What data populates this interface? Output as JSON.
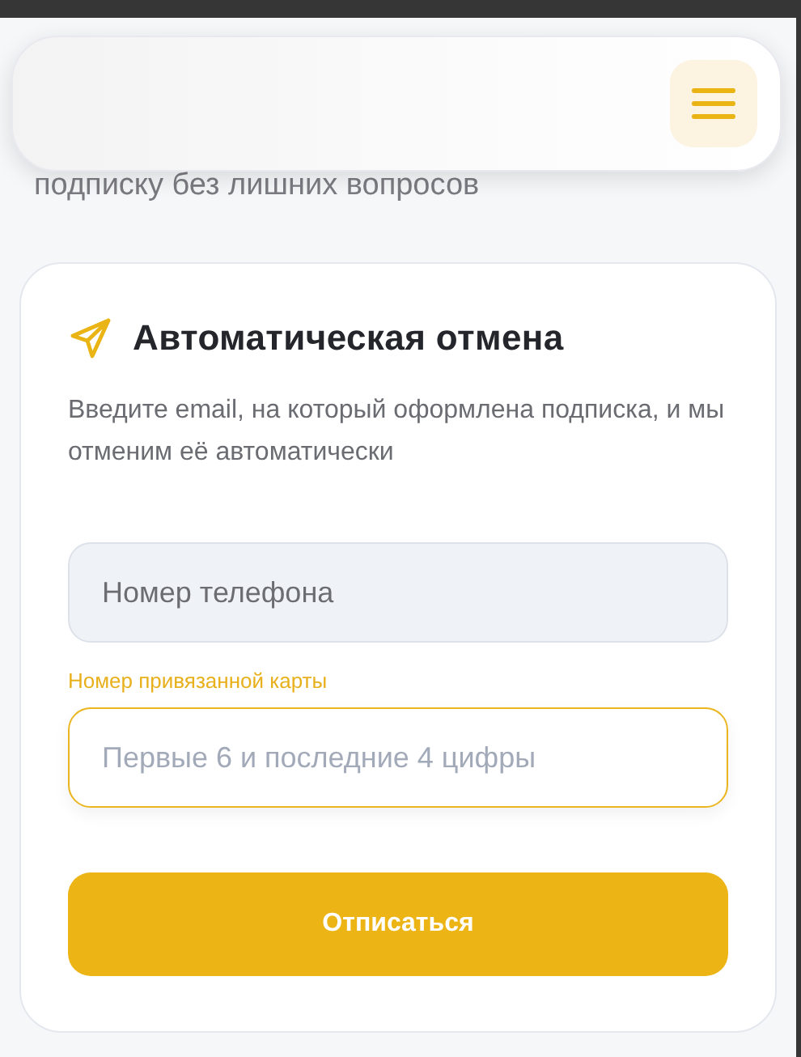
{
  "intro_text": "подписку без лишних вопросов",
  "header": {
    "menu_button": {
      "kind": "menu"
    }
  },
  "card": {
    "title": "Автоматическая отмена",
    "description": "Введите email, на который оформлена подписка, и мы отменим её автоматически",
    "fields": [
      {
        "placeholder": "Номер телефона",
        "focused": false
      },
      {
        "label": "Номер привязанной карты",
        "placeholder": "Первые 6 и последние 4 цифры",
        "focused": true
      }
    ],
    "submit_button": "Отписаться"
  }
}
